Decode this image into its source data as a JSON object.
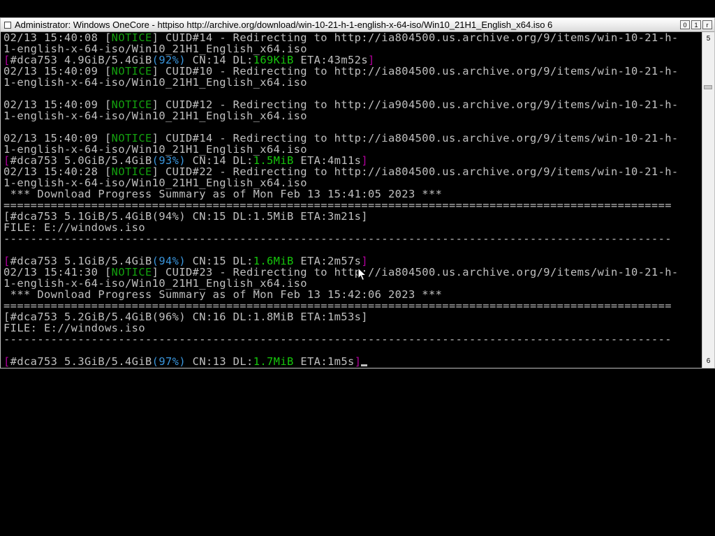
{
  "window": {
    "title": "Administrator:  Windows OneCore - httpiso  http://archive.org/download/win-10-21-h-1-english-x-64-iso/Win10_21H1_English_x64.iso 6",
    "buttons": [
      "0",
      "1",
      "r"
    ]
  },
  "scrollbar": {
    "up_label": "5",
    "down_label": "6"
  },
  "console": {
    "lines": [
      [
        {
          "t": "02/13 15:40:08 ["
        },
        {
          "t": "NOTICE",
          "c": "green"
        },
        {
          "t": "] CUID#14 - Redirecting to http://ia804500.us.archive.org/9/items/win-10-21-h-"
        }
      ],
      [
        {
          "t": "1-english-x-64-iso/Win10_21H1_English_x64.iso"
        }
      ],
      [
        {
          "t": "[",
          "c": "magenta"
        },
        {
          "t": "#dca753 4.9GiB/5.4GiB"
        },
        {
          "t": "(92%)",
          "c": "cyan"
        },
        {
          "t": " CN:14 DL:"
        },
        {
          "t": "169KiB",
          "c": "bgreen"
        },
        {
          "t": " ETA:43m52s"
        },
        {
          "t": "]",
          "c": "magenta"
        }
      ],
      [
        {
          "t": "02/13 15:40:09 ["
        },
        {
          "t": "NOTICE",
          "c": "green"
        },
        {
          "t": "] CUID#10 - Redirecting to http://ia804500.us.archive.org/9/items/win-10-21-h-"
        }
      ],
      [
        {
          "t": "1-english-x-64-iso/Win10_21H1_English_x64.iso"
        }
      ],
      [
        {
          "t": ""
        }
      ],
      [
        {
          "t": "02/13 15:40:09 ["
        },
        {
          "t": "NOTICE",
          "c": "green"
        },
        {
          "t": "] CUID#12 - Redirecting to http://ia904500.us.archive.org/9/items/win-10-21-h-"
        }
      ],
      [
        {
          "t": "1-english-x-64-iso/Win10_21H1_English_x64.iso"
        }
      ],
      [
        {
          "t": ""
        }
      ],
      [
        {
          "t": "02/13 15:40:09 ["
        },
        {
          "t": "NOTICE",
          "c": "green"
        },
        {
          "t": "] CUID#14 - Redirecting to http://ia804500.us.archive.org/9/items/win-10-21-h-"
        }
      ],
      [
        {
          "t": "1-english-x-64-iso/Win10_21H1_English_x64.iso"
        }
      ],
      [
        {
          "t": "[",
          "c": "magenta"
        },
        {
          "t": "#dca753 5.0GiB/5.4GiB"
        },
        {
          "t": "(93%)",
          "c": "cyan"
        },
        {
          "t": " CN:14 DL:"
        },
        {
          "t": "1.5MiB",
          "c": "bgreen"
        },
        {
          "t": " ETA:4m11s"
        },
        {
          "t": "]",
          "c": "magenta"
        }
      ],
      [
        {
          "t": "02/13 15:40:28 ["
        },
        {
          "t": "NOTICE",
          "c": "green"
        },
        {
          "t": "] CUID#22 - Redirecting to http://ia804500.us.archive.org/9/items/win-10-21-h-"
        }
      ],
      [
        {
          "t": "1-english-x-64-iso/Win10_21H1_English_x64.iso"
        }
      ],
      [
        {
          "t": " *** Download Progress Summary as of Mon Feb 13 15:41:05 2023 ***"
        }
      ],
      [
        {
          "t": "==================================================================================================="
        }
      ],
      [
        {
          "t": "[#dca753 5.1GiB/5.4GiB(94%) CN:15 DL:1.5MiB ETA:3m21s]"
        }
      ],
      [
        {
          "t": "FILE: E://windows.iso"
        }
      ],
      [
        {
          "t": "---------------------------------------------------------------------------------------------------"
        }
      ],
      [
        {
          "t": ""
        }
      ],
      [
        {
          "t": "[",
          "c": "magenta"
        },
        {
          "t": "#dca753 5.1GiB/5.4GiB"
        },
        {
          "t": "(94%)",
          "c": "cyan"
        },
        {
          "t": " CN:15 DL:"
        },
        {
          "t": "1.6MiB",
          "c": "bgreen"
        },
        {
          "t": " ETA:2m57s"
        },
        {
          "t": "]",
          "c": "magenta"
        }
      ],
      [
        {
          "t": "02/13 15:41:30 ["
        },
        {
          "t": "NOTICE",
          "c": "green"
        },
        {
          "t": "] CUID#23 - Redirecting to http://ia804500.us.archive.org/9/items/win-10-21-h-"
        }
      ],
      [
        {
          "t": "1-english-x-64-iso/Win10_21H1_English_x64.iso"
        }
      ],
      [
        {
          "t": " *** Download Progress Summary as of Mon Feb 13 15:42:06 2023 ***"
        }
      ],
      [
        {
          "t": "==================================================================================================="
        }
      ],
      [
        {
          "t": "[#dca753 5.2GiB/5.4GiB(96%) CN:16 DL:1.8MiB ETA:1m53s]"
        }
      ],
      [
        {
          "t": "FILE: E://windows.iso"
        }
      ],
      [
        {
          "t": "---------------------------------------------------------------------------------------------------"
        }
      ],
      [
        {
          "t": ""
        }
      ],
      [
        {
          "t": "[",
          "c": "magenta"
        },
        {
          "t": "#dca753 5.3GiB/5.4GiB"
        },
        {
          "t": "(97%)",
          "c": "cyan"
        },
        {
          "t": " CN:13 DL:"
        },
        {
          "t": "1.7MiB",
          "c": "bgreen"
        },
        {
          "t": " ETA:1m5s"
        },
        {
          "t": "]",
          "c": "magenta"
        }
      ]
    ]
  },
  "colors": {
    "background": "#000000",
    "text": "#c0c0c0",
    "notice": "#13a10e",
    "speed": "#16c60c",
    "percent": "#3a96dd",
    "bracket": "#b4009e"
  },
  "icons": {
    "system_menu": "window-icon",
    "pointer": "mouse-pointer-icon",
    "text_cursor": "text-cursor-icon"
  }
}
